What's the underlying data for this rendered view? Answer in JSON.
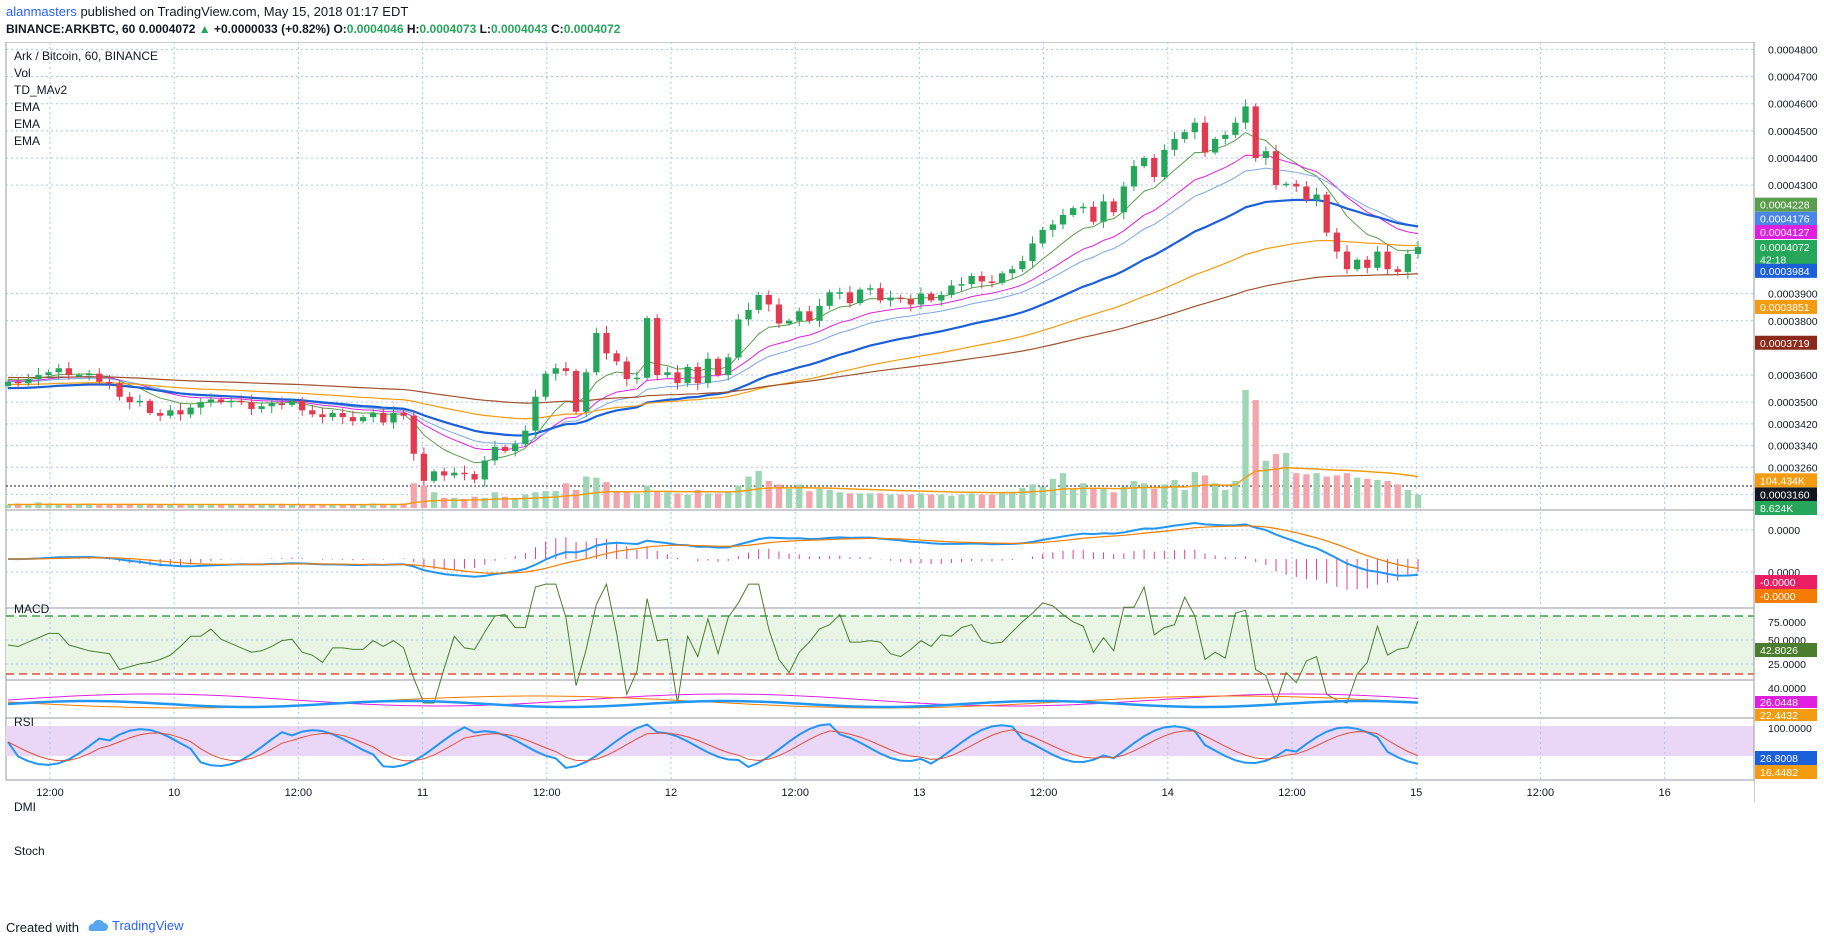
{
  "header": {
    "user": "alanmasters",
    "published": "published on TradingView.com, May 15, 2018 01:17 EDT",
    "symbol": "BINANCE:ARKBTC, 60",
    "last": "0.0004072",
    "change": "+0.0000033 (+0.82%)",
    "o_label": "O:",
    "o": "0.0004046",
    "h_label": "H:",
    "h": "0.0004073",
    "l_label": "L:",
    "l": "0.0004043",
    "c_label": "C:",
    "c": "0.0004072"
  },
  "legend": {
    "title": "Ark / Bitcoin, 60, BINANCE",
    "items": [
      "Vol",
      "TD_MAv2",
      "EMA",
      "EMA",
      "EMA"
    ]
  },
  "panes": {
    "macd": "MACD",
    "rsi": "RSI",
    "dmi": "DMI",
    "stoch": "Stoch"
  },
  "footer": {
    "created": "Created with",
    "brand": "TradingView"
  },
  "colors": {
    "up": "#26a65b",
    "down": "#e23a4e",
    "vol_up": "#9fd6b4",
    "vol_down": "#f2a5ab",
    "ema_blue": "#1b5fd9",
    "ema_orange": "#f39c12",
    "ema_brown": "#a0522d",
    "ema_magenta": "#e020e0",
    "ema_lightblue": "#7ea6e0",
    "ema_green": "#5a9e4b"
  },
  "chart_data": [
    {
      "type": "candlestick",
      "title": "Ark / Bitcoin, 60, BINANCE",
      "x_ticks": [
        "12:00",
        "10",
        "12:00",
        "11",
        "12:00",
        "12",
        "12:00",
        "13",
        "12:00",
        "14",
        "12:00",
        "15",
        "12:00",
        "16"
      ],
      "y_ticks": [
        "0.0004800",
        "0.0004700",
        "0.0004600",
        "0.0004500",
        "0.0004400",
        "0.0004300",
        "0.0003900",
        "0.0003800",
        "0.0003600",
        "0.0003500",
        "0.0003420",
        "0.0003340",
        "0.0003260",
        "0.0003160"
      ],
      "ylim": [
        0.000311,
        0.000482
      ],
      "price_labels": [
        {
          "text": "0.0004228",
          "value": 0.0004228,
          "color": "#5a9e4b"
        },
        {
          "text": "0.0004176",
          "value": 0.0004176,
          "color": "#4a86e8"
        },
        {
          "text": "0.0004127",
          "value": 0.0004127,
          "color": "#e020e0"
        },
        {
          "text": "0.0004072",
          "value": 0.0004072,
          "color": "#26a65b"
        },
        {
          "text": "42:18",
          "value": 0.0004025,
          "color": "#26a65b"
        },
        {
          "text": "0.0003984",
          "value": 0.0003984,
          "color": "#1b5fd9"
        },
        {
          "text": "0.0003851",
          "value": 0.0003851,
          "color": "#f39c12"
        },
        {
          "text": "0.0003719",
          "value": 0.0003719,
          "color": "#8b2a1a"
        },
        {
          "text": "104.434K",
          "value": 0.0003212,
          "color": "#f39c12"
        },
        {
          "text": "0.0003160",
          "value": 0.000316,
          "color": "#131722"
        },
        {
          "text": "8.624K",
          "value": 0.000311,
          "color": "#26a65b"
        }
      ],
      "series": [
        {
          "name": "Vol",
          "kind": "volume"
        },
        {
          "name": "EMA",
          "kind": "ema",
          "last": 0.0003984
        },
        {
          "name": "EMA",
          "kind": "ema",
          "last": 0.0003851
        },
        {
          "name": "EMA",
          "kind": "ema",
          "last": 0.0003719
        }
      ],
      "closes": [
        0.0003575,
        0.000357,
        0.0003585,
        0.00036,
        0.000361,
        0.0003625,
        0.00036,
        0.00036,
        0.0003605,
        0.0003575,
        0.000357,
        0.000352,
        0.00035,
        0.0003505,
        0.000346,
        0.000345,
        0.000347,
        0.0003455,
        0.000348,
        0.00035,
        0.000351,
        0.00035,
        0.0003505,
        0.00035,
        0.0003475,
        0.0003485,
        0.0003495,
        0.000349,
        0.0003505,
        0.000347,
        0.0003455,
        0.0003445,
        0.000346,
        0.0003445,
        0.000343,
        0.0003445,
        0.000346,
        0.0003425,
        0.000346,
        0.000345,
        0.000331,
        0.000321,
        0.0003245,
        0.000323,
        0.000324,
        0.0003235,
        0.0003215,
        0.0003285,
        0.0003335,
        0.000332,
        0.0003345,
        0.0003395,
        0.000352,
        0.0003605,
        0.0003625,
        0.0003615,
        0.0003465,
        0.000361,
        0.0003755,
        0.000368,
        0.000365,
        0.0003585,
        0.000359,
        0.000381,
        0.00036,
        0.000361,
        0.000357,
        0.000363,
        0.000357,
        0.000366,
        0.00036,
        0.0003665,
        0.0003805,
        0.000384,
        0.0003895,
        0.000386,
        0.000379,
        0.00038,
        0.0003835,
        0.00038,
        0.0003855,
        0.0003905,
        0.0003905,
        0.0003865,
        0.0003915,
        0.000392,
        0.0003875,
        0.0003885,
        0.000388,
        0.000386,
        0.00039,
        0.0003875,
        0.0003895,
        0.000393,
        0.0003935,
        0.0003965,
        0.0003945,
        0.000394,
        0.0003975,
        0.000399,
        0.000402,
        0.0004085,
        0.0004135,
        0.0004155,
        0.000419,
        0.0004215,
        0.000422,
        0.0004165,
        0.000424,
        0.00042,
        0.0004295,
        0.000437,
        0.00044,
        0.000433,
        0.000443,
        0.000447,
        0.0004495,
        0.000453,
        0.000442,
        0.000447,
        0.0004485,
        0.000453,
        0.000459,
        0.00044,
        0.0004425,
        0.00043,
        0.0004305,
        0.0004295,
        0.0004245,
        0.0004265,
        0.0004125,
        0.0004055,
        0.000399,
        0.0004025,
        0.0003995,
        0.0004055,
        0.000399,
        0.000398,
        0.0004046,
        0.0004072
      ],
      "volume": [
        0.3,
        0.4,
        0.3,
        0.5,
        0.4,
        0.3,
        0.3,
        0.3,
        0.4,
        0.3,
        0.3,
        0.3,
        0.3,
        0.3,
        0.3,
        0.3,
        0.3,
        0.3,
        0.3,
        0.3,
        0.3,
        0.3,
        0.3,
        0.3,
        0.3,
        0.3,
        0.3,
        0.3,
        0.3,
        0.3,
        0.3,
        0.3,
        0.3,
        0.3,
        0.3,
        0.3,
        0.4,
        0.3,
        0.3,
        0.4,
        2.2,
        2.0,
        1.4,
        0.9,
        0.9,
        0.8,
        1.0,
        0.9,
        1.4,
        1.0,
        0.9,
        1.2,
        1.4,
        1.5,
        1.5,
        2.2,
        1.6,
        2.8,
        2.7,
        2.3,
        1.5,
        1.4,
        1.3,
        2.0,
        1.5,
        1.4,
        1.3,
        1.2,
        1.6,
        1.3,
        1.3,
        1.4,
        2.0,
        2.8,
        3.3,
        2.4,
        2.1,
        1.7,
        2.1,
        1.5,
        1.7,
        1.6,
        1.4,
        1.3,
        1.3,
        1.3,
        1.3,
        1.2,
        1.2,
        1.2,
        1.3,
        1.2,
        1.2,
        1.1,
        1.2,
        1.3,
        1.2,
        1.2,
        1.3,
        1.4,
        1.8,
        2.1,
        1.9,
        2.6,
        3.1,
        1.7,
        2.2,
        1.8,
        1.8,
        1.4,
        1.9,
        2.4,
        2.2,
        1.7,
        2.1,
        2.5,
        1.6,
        3.2,
        2.9,
        2.2,
        1.6,
        2.4,
        10.5,
        9.6,
        4.2,
        4.8,
        4.9,
        3.1,
        3.0,
        3.1,
        2.8,
        2.9,
        3.1,
        2.7,
        2.6,
        2.5,
        2.4,
        2.1,
        1.6,
        1.2
      ]
    },
    {
      "type": "line",
      "title": "MACD",
      "y_ticks": [
        "0.0000",
        "0.0000"
      ],
      "labels": [
        "-0.0000",
        "-0.0000"
      ]
    },
    {
      "type": "line",
      "title": "RSI",
      "y_ticks": [
        "75.0000",
        "50.0000",
        "25.0000"
      ],
      "ylim": [
        0,
        100
      ],
      "last": 42.8026,
      "last_label": "42.8026",
      "bands": [
        70,
        30
      ]
    },
    {
      "type": "line",
      "title": "DMI",
      "y_ticks": [
        "40.0000"
      ],
      "ylim": [
        0,
        50
      ],
      "labels": [
        {
          "text": "26.0448",
          "color": "#e020e0"
        },
        {
          "text": "22.4432",
          "color": "#f39c12"
        }
      ]
    },
    {
      "type": "line",
      "title": "Stoch",
      "y_ticks": [
        "100.0000"
      ],
      "ylim": [
        0,
        100
      ],
      "labels": [
        {
          "text": "26.8008",
          "color": "#1b5fd9"
        },
        {
          "text": "16.4482",
          "color": "#f39c12"
        }
      ]
    }
  ]
}
